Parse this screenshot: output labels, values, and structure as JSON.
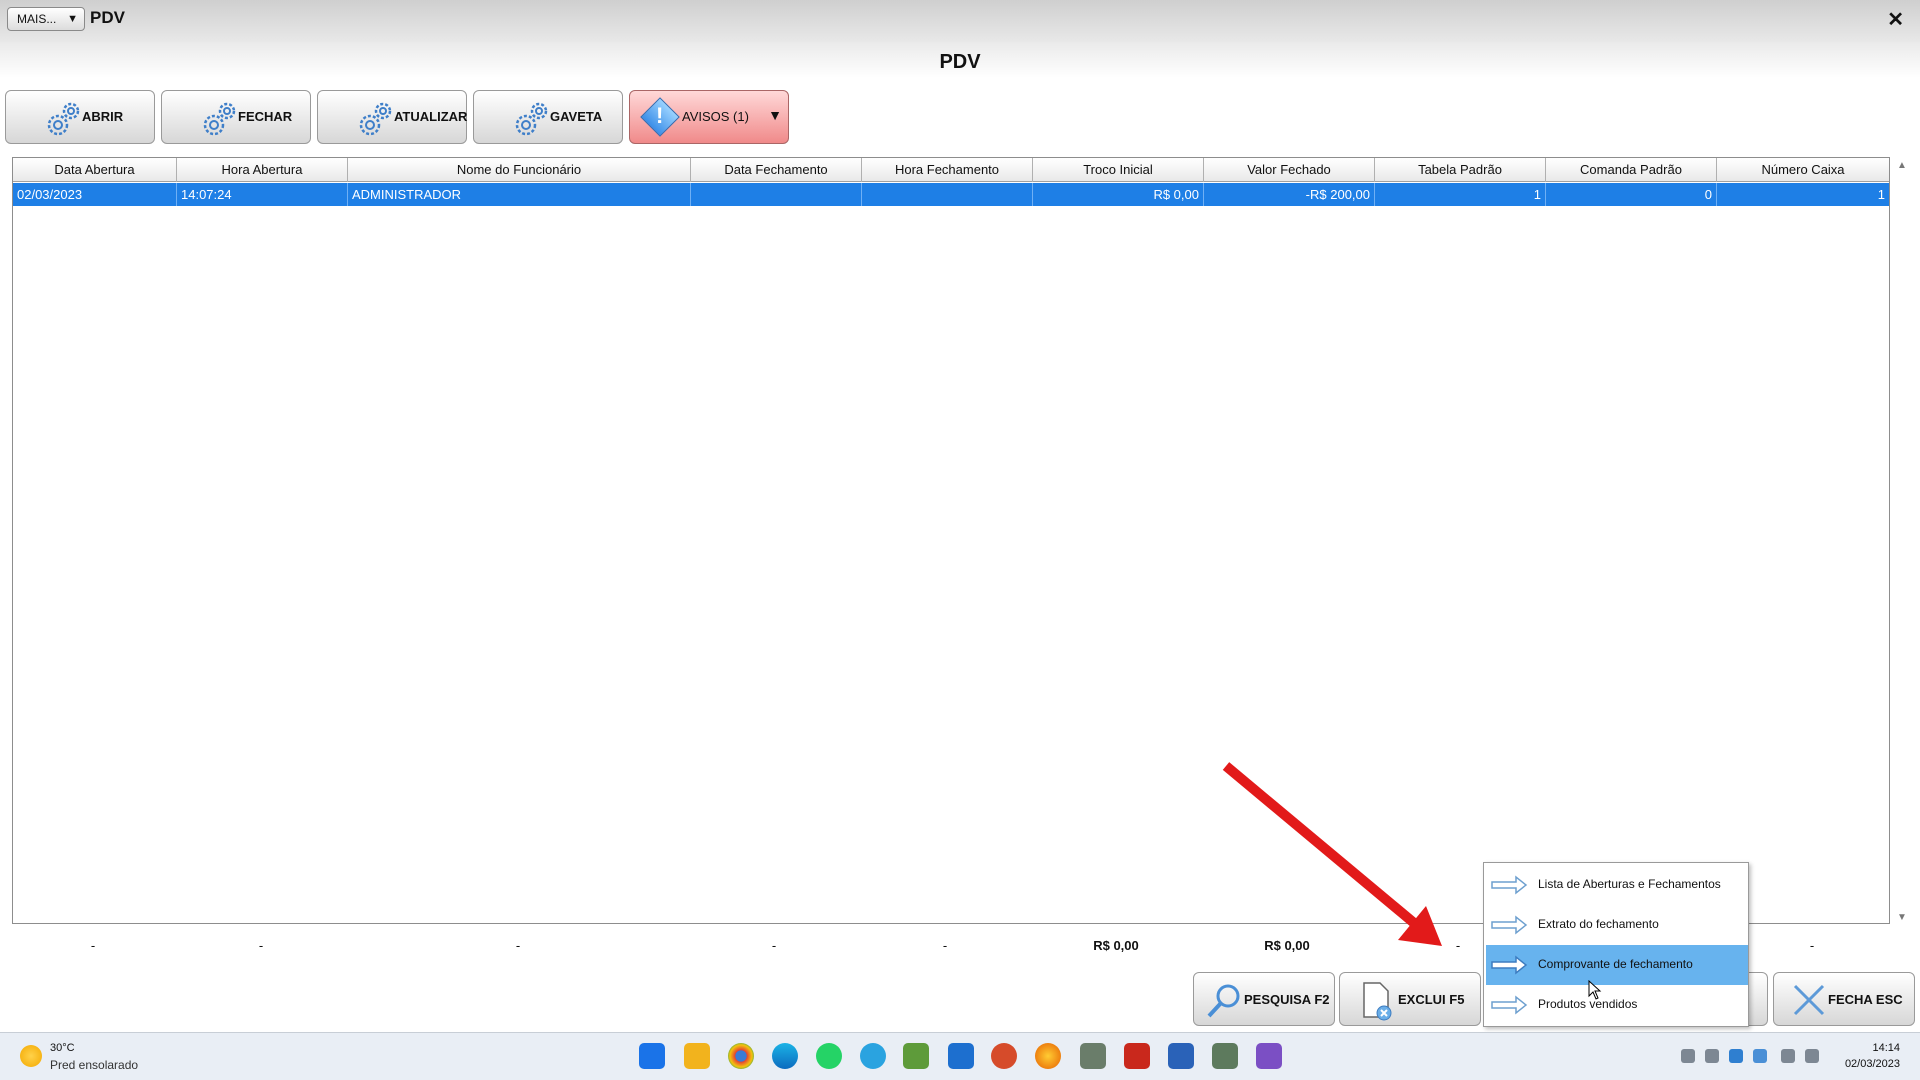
{
  "window": {
    "more_label": "MAIS...",
    "title": "PDV",
    "heading": "PDV"
  },
  "toolbar": {
    "abrir": "ABRIR",
    "fechar": "FECHAR",
    "atualizar": "ATUALIZAR",
    "gaveta": "GAVETA",
    "avisos": "AVISOS (1)"
  },
  "grid": {
    "columns": [
      "Data Abertura",
      "Hora Abertura",
      "Nome do Funcionário",
      "Data Fechamento",
      "Hora Fechamento",
      "Troco Inicial",
      "Valor Fechado",
      "Tabela Padrão",
      "Comanda Padrão",
      "Número Caixa"
    ],
    "rows": [
      [
        "02/03/2023",
        "14:07:24",
        "ADMINISTRADOR",
        "",
        "",
        "R$ 0,00",
        "-R$ 200,00",
        "1",
        "0",
        "1"
      ]
    ]
  },
  "totals": [
    "-",
    "-",
    "-",
    "-",
    "-",
    "R$ 0,00",
    "R$ 0,00",
    "-",
    "-",
    "-"
  ],
  "bottom_buttons": {
    "pesquisa": "PESQUISA F2",
    "exclui": "EXCLUI F5",
    "fecha": "FECHA ESC"
  },
  "popup_menu": {
    "items": [
      "Lista de Aberturas e Fechamentos",
      "Extrato do fechamento",
      "Comprovante de fechamento",
      "Produtos vendidos"
    ],
    "selected_index": 2
  },
  "taskbar": {
    "weather_temp": "30°C",
    "weather_desc": "Pred ensolarado",
    "time": "14:14",
    "date": "02/03/2023"
  },
  "colors": {
    "selection_blue": "#1e7fe6",
    "menu_highlight": "#67b3ee",
    "annotation_arrow": "#e21a1a",
    "avisos_red": "#f08a8a"
  }
}
